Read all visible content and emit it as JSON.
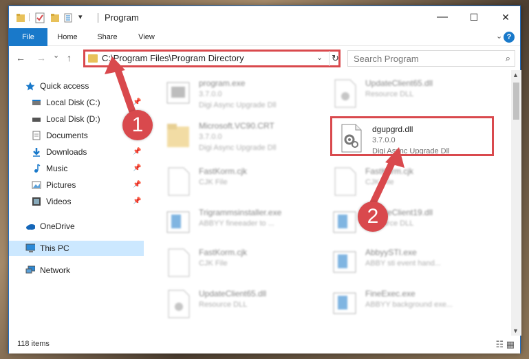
{
  "window": {
    "title": "Program",
    "minimize": "—",
    "maximize": "☐",
    "close": "✕"
  },
  "ribbon": {
    "tabs": [
      {
        "label": "File"
      },
      {
        "label": "Home"
      },
      {
        "label": "Share"
      },
      {
        "label": "View"
      }
    ],
    "expand_icon": "chevron-down-icon",
    "help": "?"
  },
  "navigation": {
    "back": "←",
    "forward": "→",
    "recent": "⌄",
    "up": "↑",
    "address": "C:\\Program Files\\Program Directory",
    "refresh": "↻",
    "search_placeholder": "Search Program",
    "search_icon": "⌕"
  },
  "sidebar": {
    "items": [
      {
        "label": "Quick access",
        "icon": "star-icon"
      },
      {
        "label": "Local Disk (C:)",
        "icon": "drive-icon",
        "pinned": true
      },
      {
        "label": "Local Disk (D:)",
        "icon": "drive-icon",
        "pinned": false
      },
      {
        "label": "Documents",
        "icon": "documents-icon",
        "pinned": true
      },
      {
        "label": "Downloads",
        "icon": "download-icon",
        "pinned": true
      },
      {
        "label": "Music",
        "icon": "music-icon",
        "pinned": true
      },
      {
        "label": "Pictures",
        "icon": "pictures-icon",
        "pinned": true
      },
      {
        "label": "Videos",
        "icon": "videos-icon",
        "pinned": true
      },
      {
        "label": "OneDrive",
        "icon": "cloud-icon"
      },
      {
        "label": "This PC",
        "icon": "computer-icon",
        "selected": true
      },
      {
        "label": "Network",
        "icon": "network-icon"
      }
    ]
  },
  "files": [
    {
      "name": "program.exe",
      "version": "3.7.0.0",
      "desc": "Digi Async Upgrade Dll",
      "icon": "exe-icon"
    },
    {
      "name": "UpdateClient65.dll",
      "version": "",
      "desc": "Resource DLL",
      "icon": "dll-icon"
    },
    {
      "name": "Microsoft.VC90.CRT",
      "version": "3.7.0.0",
      "desc": "Digi Async Upgrade Dll",
      "icon": "folder-icon"
    },
    {
      "name": "dgupgrd.dll",
      "version": "3.7.0.0",
      "desc": "Digi Async Upgrade Dll",
      "icon": "dll-icon"
    },
    {
      "name": "FastKorm.cjk",
      "version": "",
      "desc": "CJK File",
      "icon": "file-icon"
    },
    {
      "name": "FastKorm.cjk",
      "version": "",
      "desc": "CJK File",
      "icon": "file-icon"
    },
    {
      "name": "Trigrammsinstaller.exe",
      "version": "",
      "desc": "ABBYY fineeader to ...",
      "icon": "exe-icon"
    },
    {
      "name": "UpdateClient19.dll",
      "version": "",
      "desc": "Resource DLL",
      "icon": "exe-icon"
    },
    {
      "name": "FastKorm.cjk",
      "version": "",
      "desc": "CJK File",
      "icon": "file-icon"
    },
    {
      "name": "AbbyySTI.exe",
      "version": "",
      "desc": "ABBY sti event hand...",
      "icon": "exe-icon"
    },
    {
      "name": "UpdateClient65.dll",
      "version": "",
      "desc": "Resource DLL",
      "icon": "dll-icon"
    },
    {
      "name": "FineExec.exe",
      "version": "",
      "desc": "ABBYY background exe...",
      "icon": "exe-icon"
    }
  ],
  "status": {
    "count": "118 items"
  },
  "annotations": {
    "step1": "1",
    "step2": "2",
    "color": "#d9494d"
  }
}
